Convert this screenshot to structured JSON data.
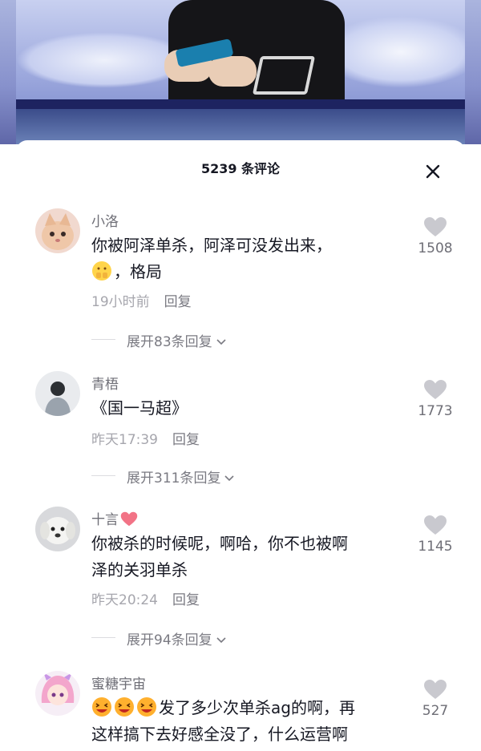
{
  "colors": {
    "accent_heart": "#fe2c55",
    "heart_outline": "#c9c9cf"
  },
  "sheet": {
    "title": "5239 条评论",
    "close_icon": "close-icon"
  },
  "comments": [
    {
      "username": "小洛",
      "has_heart_badge": false,
      "text_line1": "你被阿泽单杀，阿泽可没发出来，",
      "text_line2": "，格局",
      "inline_emoji": "thumbs-up-fists-emoji",
      "time": "19小时前",
      "reply_label": "回复",
      "expand_label": "展开83条回复",
      "likes": "1508"
    },
    {
      "username": "青梧",
      "has_heart_badge": false,
      "text_line1": "《国一马超》",
      "time": "昨天17:39",
      "reply_label": "回复",
      "expand_label": "展开311条回复",
      "likes": "1773"
    },
    {
      "username": "十言",
      "has_heart_badge": true,
      "text_line1": "你被杀的时候呢，啊哈，你不也被啊",
      "text_line2": "泽的关羽单杀",
      "time": "昨天20:24",
      "reply_label": "回复",
      "expand_label": "展开94条回复",
      "likes": "1145"
    },
    {
      "username": "蜜糖宇宙",
      "has_heart_badge": false,
      "text_line1": "发了多少次单杀ag的啊，再",
      "text_line2": "这样搞下去好感全没了，什么运营啊",
      "inline_emoji": "grinning-squint-emoji",
      "likes": "527"
    }
  ]
}
